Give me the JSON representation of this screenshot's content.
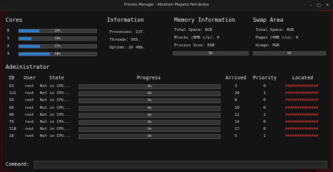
{
  "window": {
    "title": "Process Manager - Abraham Magaña Hernández",
    "buttons": [
      "–",
      "□",
      "✕"
    ]
  },
  "cores": {
    "heading": "Cores",
    "items": [
      {
        "index": "0",
        "percent_label": "26%",
        "value": 0.26
      },
      {
        "index": "1",
        "percent_label": "16%",
        "value": 0.16
      },
      {
        "index": "2",
        "percent_label": "27%",
        "value": 0.27
      },
      {
        "index": "3",
        "percent_label": "40%",
        "value": 0.4
      }
    ]
  },
  "information": {
    "heading": "Information",
    "processes": "Processes: 137.",
    "threads": "Threads: 565.",
    "uptime": "Uptime: 2h 48m."
  },
  "memory": {
    "heading": "Memory Information",
    "total_space": "Total Space: 8GB",
    "blocks": "Blocks (8MB c/u): 0",
    "process_size": "Process Size: 0GB",
    "usage_label": "0%",
    "usage_value": 0
  },
  "swap": {
    "heading": "Swap Area",
    "total_space": "Total Space: 4GB",
    "pages": "Pages (4MB c/u): 0",
    "usage": "Usage: 0GB",
    "usage_label": "0%",
    "usage_value": 0
  },
  "admin": {
    "heading": "Administrator",
    "columns": {
      "id": "ID",
      "user": "User",
      "state": "State",
      "progress": "Progress",
      "arrived": "Arrived",
      "priority": "Priority",
      "located": "Located"
    },
    "rows": [
      {
        "id": "63",
        "user": "root",
        "state": "Not in CPU...",
        "progress": "0%",
        "arrived": "3",
        "priority": "0",
        "located": "##############"
      },
      {
        "id": "111",
        "user": "root",
        "state": "Not in CPU...",
        "progress": "0%",
        "arrived": "20",
        "priority": "1",
        "located": "##############"
      },
      {
        "id": "55",
        "user": "root",
        "state": "Not in CPU...",
        "progress": "0%",
        "arrived": "8",
        "priority": "0",
        "located": "##############"
      },
      {
        "id": "66",
        "user": "root",
        "state": "Not in CPU...",
        "progress": "0%",
        "arrived": "10",
        "priority": "0",
        "located": "##############"
      },
      {
        "id": "90",
        "user": "root",
        "state": "Not in CPU...",
        "progress": "0%",
        "arrived": "12",
        "priority": "2",
        "located": "##############"
      },
      {
        "id": "76",
        "user": "root",
        "state": "Not in CPU...",
        "progress": "0%",
        "arrived": "14",
        "priority": "0",
        "located": "##############"
      },
      {
        "id": "118",
        "user": "root",
        "state": "Not in CPU...",
        "progress": "0%",
        "arrived": "17",
        "priority": "0",
        "located": "##############"
      },
      {
        "id": "18",
        "user": "root",
        "state": "Not in CPU...",
        "progress": "0%",
        "arrived": "5",
        "priority": "1",
        "located": "##############"
      }
    ]
  },
  "command": {
    "label": "Command:",
    "value": ""
  },
  "colors": {
    "bar_fill": "#2f7fd0",
    "located": "#d03030",
    "background": "#141414"
  }
}
